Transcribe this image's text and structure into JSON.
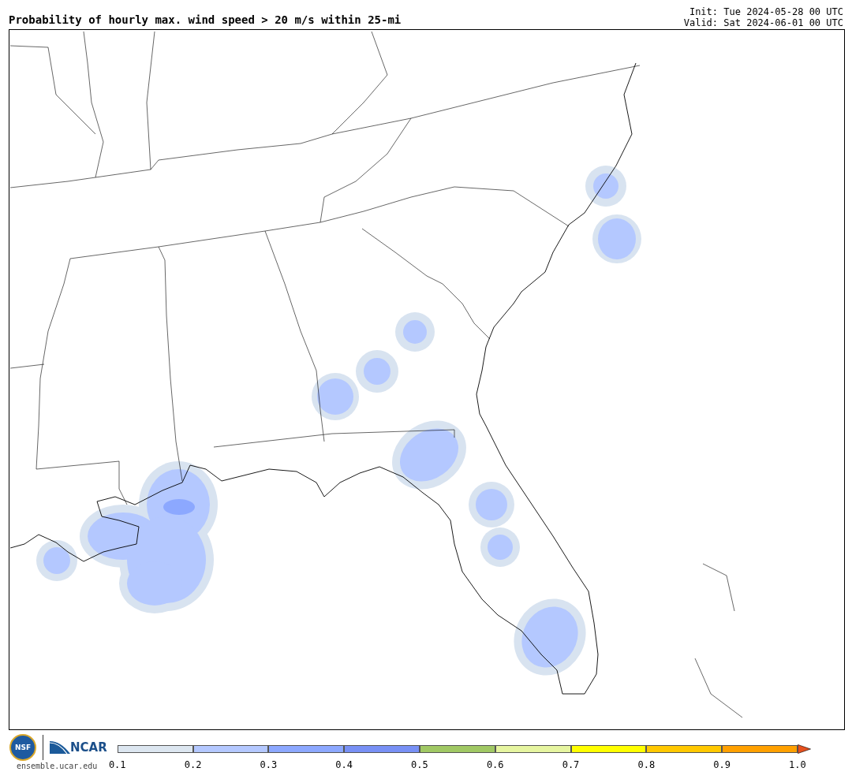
{
  "title": "Probability of hourly max. wind speed > 20 m/s within 25-mi",
  "init": "Init: Tue 2024-05-28 00 UTC",
  "valid": "Valid: Sat 2024-06-01 00 UTC",
  "logo": {
    "nsf": "NSF",
    "ncar": "NCAR",
    "site": "ensemble.ucar.edu"
  },
  "colorbar": {
    "bins": [
      {
        "kind": "box",
        "color": "#dce6f0"
      },
      {
        "kind": "box",
        "color": "#b4c8ff"
      },
      {
        "kind": "box",
        "color": "#8ca8ff"
      },
      {
        "kind": "box",
        "color": "#7890f5"
      },
      {
        "kind": "box",
        "color": "#a0c864"
      },
      {
        "kind": "box",
        "color": "#e6f5a0"
      },
      {
        "kind": "box",
        "color": "#ffff00"
      },
      {
        "kind": "box",
        "color": "#ffc800"
      },
      {
        "kind": "box",
        "color": "#ffa000"
      },
      {
        "kind": "arrow",
        "color": "#e6501e"
      }
    ],
    "ticks": [
      "0.1",
      "0.2",
      "0.3",
      "0.4",
      "0.5",
      "0.6",
      "0.7",
      "0.8",
      "0.9",
      "1.0"
    ]
  }
}
